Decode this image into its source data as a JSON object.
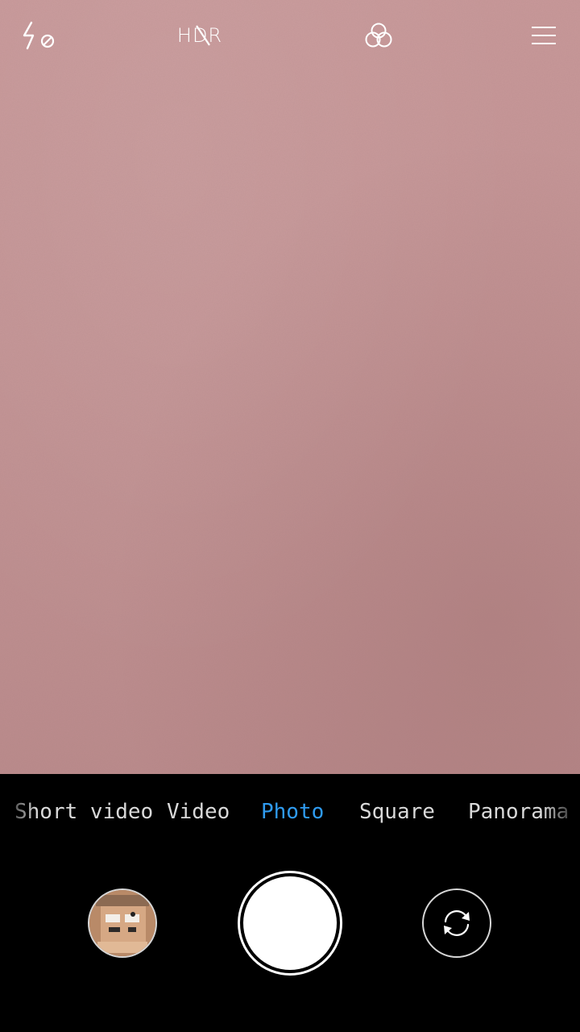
{
  "top_bar": {
    "flash_icon": "flash-off-icon",
    "hdr_label": "HDR",
    "hdr_icon": "hdr-off-icon",
    "filter_icon": "filters-icon",
    "menu_icon": "menu-icon"
  },
  "modes": {
    "short_video": "Short video",
    "video": "Video",
    "photo": "Photo",
    "square": "Square",
    "panorama": "Panorama",
    "active": "Photo"
  },
  "controls": {
    "gallery_icon": "gallery-thumbnail",
    "shutter_icon": "shutter-button",
    "switch_icon": "switch-camera-icon"
  },
  "colors": {
    "accent": "#2f9bf0",
    "viewfinder": "#c49495",
    "panel": "#000000"
  }
}
